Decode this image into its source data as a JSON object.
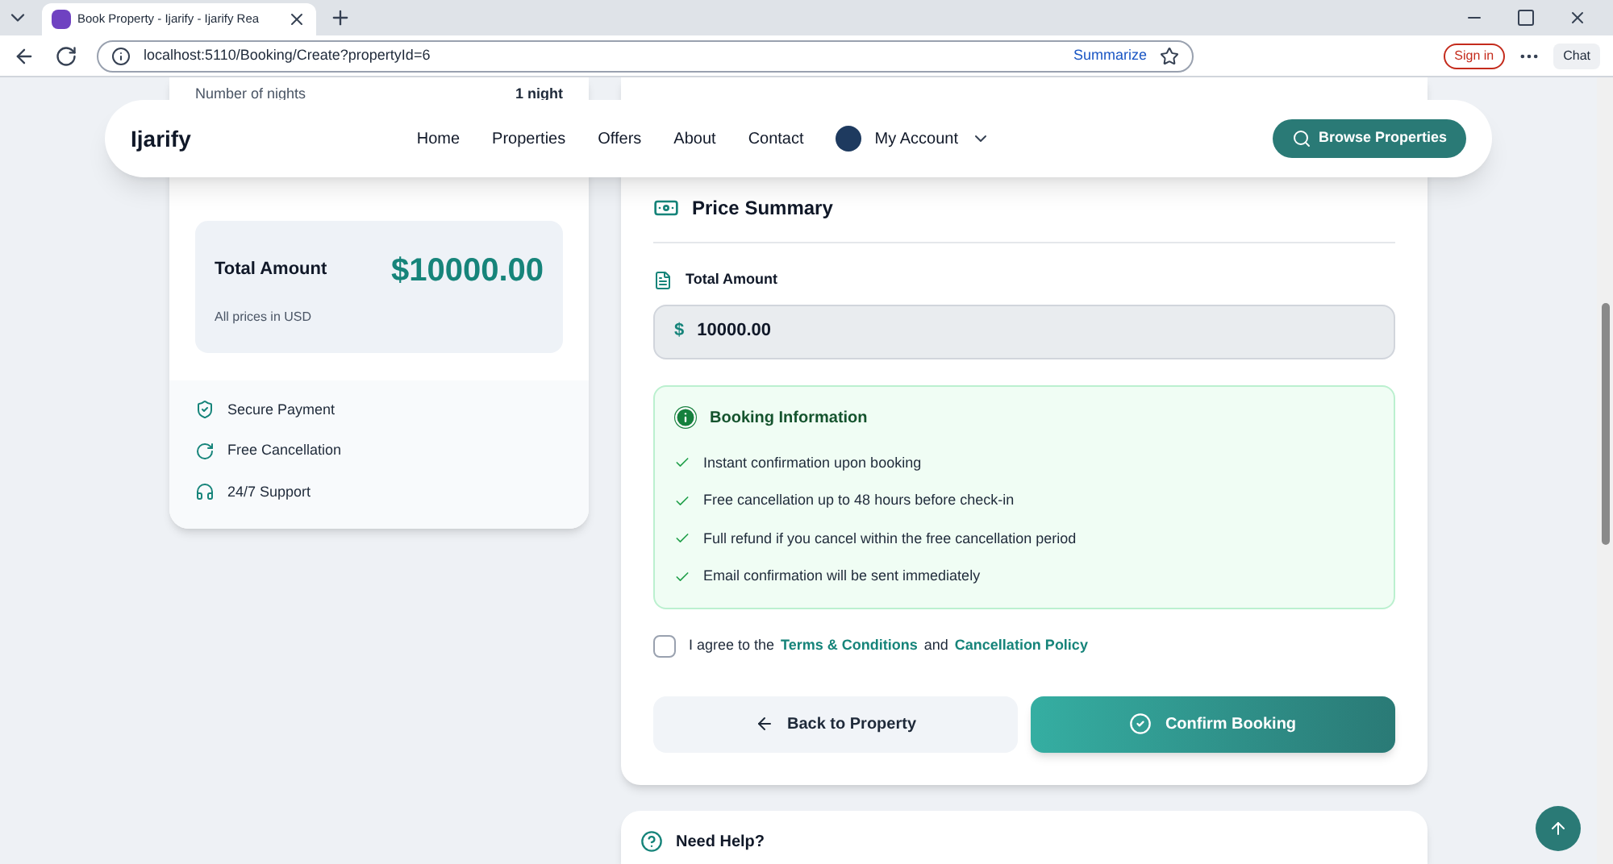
{
  "browser": {
    "tab_title": "Book Property - Ijarify - Ijarify Rea",
    "url": "localhost:5110/Booking/Create?propertyId=6",
    "summarize": "Summarize",
    "sign_in": "Sign in",
    "chat": "Chat"
  },
  "navbar": {
    "brand": "Ijarify",
    "links": [
      "Home",
      "Properties",
      "Offers",
      "About",
      "Contact"
    ],
    "account": "My Account",
    "browse": "Browse Properties"
  },
  "summary_card": {
    "nights_label": "Number of nights",
    "nights_value": "1 night",
    "total_label": "Total Amount",
    "total_value": "$10000.00",
    "currency_note": "All prices in USD",
    "features": [
      {
        "kind": "shield",
        "text": "Secure Payment"
      },
      {
        "kind": "refresh",
        "text": "Free Cancellation"
      },
      {
        "kind": "headset",
        "text": "24/7 Support"
      }
    ]
  },
  "price_summary": {
    "title": "Price Summary",
    "field_label": "Total Amount",
    "currency_symbol": "$",
    "value": "10000.00"
  },
  "booking_info": {
    "title": "Booking Information",
    "items": [
      "Instant confirmation upon booking",
      "Free cancellation up to 48 hours before check-in",
      "Full refund if you cancel within the free cancellation period",
      "Email confirmation will be sent immediately"
    ]
  },
  "agree": {
    "checked": false,
    "prefix": "I agree to the",
    "terms_link": "Terms & Conditions",
    "joiner": "and",
    "policy_link": "Cancellation Policy"
  },
  "buttons": {
    "back": "Back to Property",
    "confirm": "Confirm Booking"
  },
  "help": {
    "title": "Need Help?"
  }
}
